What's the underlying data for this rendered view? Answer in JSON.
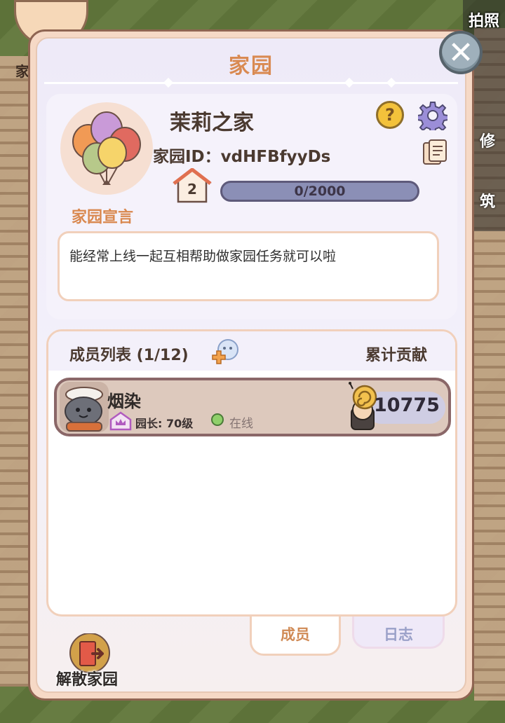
{
  "background": {
    "top_left_label": "家",
    "photo_label": "拍照",
    "right_label_1": "修",
    "right_label_2": "筑"
  },
  "panel": {
    "title": "家园",
    "close_icon": "close-icon"
  },
  "home": {
    "name": "茉莉之家",
    "id_text": "家园ID：vdHFBfyyDs",
    "level": "2",
    "xp_text": "0/2000",
    "xp_fraction": 0,
    "manifesto_label": "家园宣言",
    "manifesto_text": "能经常上线一起互相帮助做家园任务就可以啦",
    "icons": [
      "balloons-avatar-icon",
      "help-icon",
      "gear-icon",
      "copy-icon",
      "house-level-icon"
    ]
  },
  "members": {
    "title": "成员列表 (1/12)",
    "total_label": "累计贡献",
    "rows": [
      {
        "name": "烟染",
        "role": "园长: 70级",
        "status": "在线",
        "contribution": "10775"
      }
    ]
  },
  "tabs": {
    "members": "成员",
    "logs": "日志"
  },
  "actions": {
    "disband": "解散家园"
  },
  "colors": {
    "title_orange": "#d98a52",
    "panel_border": "#8f6552",
    "row_border": "#8a6768",
    "online_green": "#8fd06a"
  }
}
